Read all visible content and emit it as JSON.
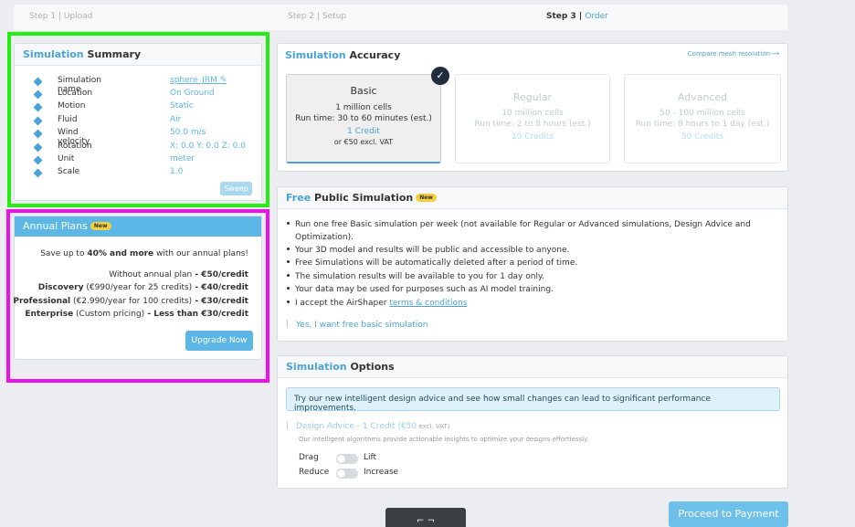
{
  "steps": [
    {
      "num": "Step 1",
      "sep": " | ",
      "name": "Upload"
    },
    {
      "num": "Step 2",
      "sep": " | ",
      "name": "Setup"
    },
    {
      "num": "Step 3",
      "sep": " | ",
      "name": "Order"
    }
  ],
  "summary": {
    "title_a": "Simulation",
    "title_b": " Summary",
    "rows": [
      {
        "label": "Simulation name",
        "value": "sphere_JRM"
      },
      {
        "label": "Location",
        "value": "On Ground"
      },
      {
        "label": "Motion",
        "value": "Static"
      },
      {
        "label": "Fluid",
        "value": "Air"
      },
      {
        "label": "Wind velocity",
        "value": "50.0 m/s"
      },
      {
        "label": "Rotation",
        "value": "X: 0.0 Y: 0.0 Z: 0.0"
      },
      {
        "label": "Unit",
        "value": "meter"
      },
      {
        "label": "Scale",
        "value": "1.0"
      }
    ],
    "sweep_label": "Sweep"
  },
  "annual": {
    "title": "Annual Plans",
    "badge": "New",
    "intro_pre": "Save up to ",
    "intro_bold": "40% and more",
    "intro_post": " with our annual plans!",
    "lines": [
      {
        "a": "Without annual plan",
        "b": "",
        "c": " - €50/credit"
      },
      {
        "a": "Discovery",
        "b": " (€990/year for 25 credits)",
        "c": " - €40/credit"
      },
      {
        "a": "Professional",
        "b": " (€2.990/year for 100 credits)",
        "c": " - €30/credit"
      },
      {
        "a": "Enterprise",
        "b": " (Custom pricing)",
        "c": " - Less than €30/credit"
      }
    ],
    "upgrade_label": "Upgrade Now"
  },
  "accuracy": {
    "title_a": "Simulation",
    "title_b": " Accuracy",
    "compare_link": "Compare mesh resolution⟶",
    "cards": [
      {
        "name": "Basic",
        "cells": "1 million cells",
        "runtime": "Run time: 30 to 60 minutes (est.)",
        "credits": "1 Credit",
        "price": "or €50 excl. VAT",
        "selected": true
      },
      {
        "name": "Regular",
        "cells": "10 million cells",
        "runtime": "Run time: 2 to 8 hours (est.)",
        "credits": "10 Credits",
        "price": "",
        "selected": false
      },
      {
        "name": "Advanced",
        "cells": "50 - 100 million cells",
        "runtime": "Run time: 8 hours to 1 day (est.)",
        "credits": "50 Credits",
        "price": "",
        "selected": false
      }
    ]
  },
  "free": {
    "title_a": "Free",
    "title_b": " Public Simulation",
    "badge": "New",
    "items": [
      "Run one free Basic simulation per week (not available for Regular or Advanced simulations, Design Advice and",
      "Optimization).",
      "Your 3D model and results will be public and accessible to anyone.",
      "Free Simulations will be automatically deleted after a period of time.",
      "The simulation results will be available to you for 1 day only.",
      "Your data may be used for purposes such as AI model training.",
      "I accept the AirShaper "
    ],
    "terms_link": "terms & conditions",
    "checkbox_label": "Yes, I want free basic simulation"
  },
  "options": {
    "title_a": "Simulation",
    "title_b": " Options",
    "banner": "Try our new intelligent design advice and see how small changes can lead to significant performance improvements.",
    "design_advice": "Design Advice - 1 Credit (€50",
    "design_advice_vat": " excl. VAT)",
    "desc": "Our intelligent algorithms provide actionable insights to optimize your designs effortlessly.",
    "toggles": [
      {
        "left": "Drag",
        "right": "Lift"
      },
      {
        "left": "Reduce",
        "right": "Increase"
      }
    ]
  },
  "footer": {
    "proceed_label": "Proceed to Payment",
    "dark_label": "⌐   ¬"
  },
  "colors": {
    "accent": "#4aa3d8",
    "badge": "#f5cf3c",
    "highlight_green": "#22ee11",
    "highlight_pink": "#ee11ee"
  }
}
